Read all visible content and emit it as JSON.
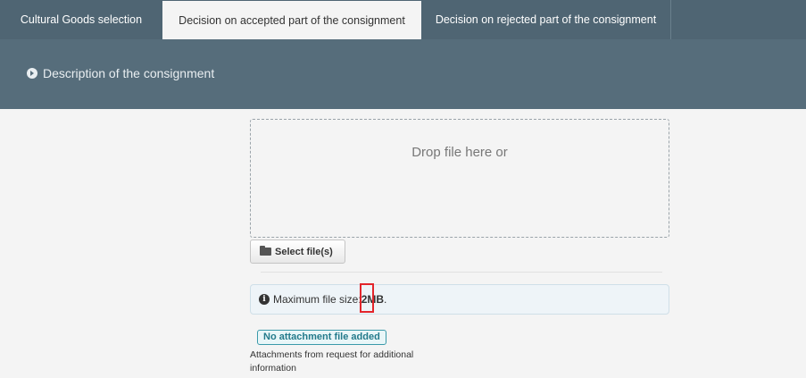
{
  "tabs": [
    {
      "label": "Cultural Goods selection",
      "active": false
    },
    {
      "label": "Decision on accepted part of the consignment",
      "active": true
    },
    {
      "label": "Decision on rejected part of the consignment",
      "active": false
    }
  ],
  "description_section": {
    "label": "Description of the consignment",
    "icon": "chevron-circle-right-icon"
  },
  "upload": {
    "dropzone_text": "Drop file here or",
    "select_button_label": "Select file(s)",
    "select_button_icon": "folder-open-icon"
  },
  "file_info": {
    "icon": "info-circle-icon",
    "prefix": "Maximum file size: ",
    "size_value": "2",
    "size_unit": " MB",
    "suffix": "."
  },
  "attachments": {
    "status_badge": "No attachment file added",
    "label": "Attachments from request for additional information"
  },
  "colors": {
    "tab_bar": "#4f6573",
    "description_bar": "#566d7b",
    "highlight": "#e3252b",
    "badge": "#237a8b"
  }
}
